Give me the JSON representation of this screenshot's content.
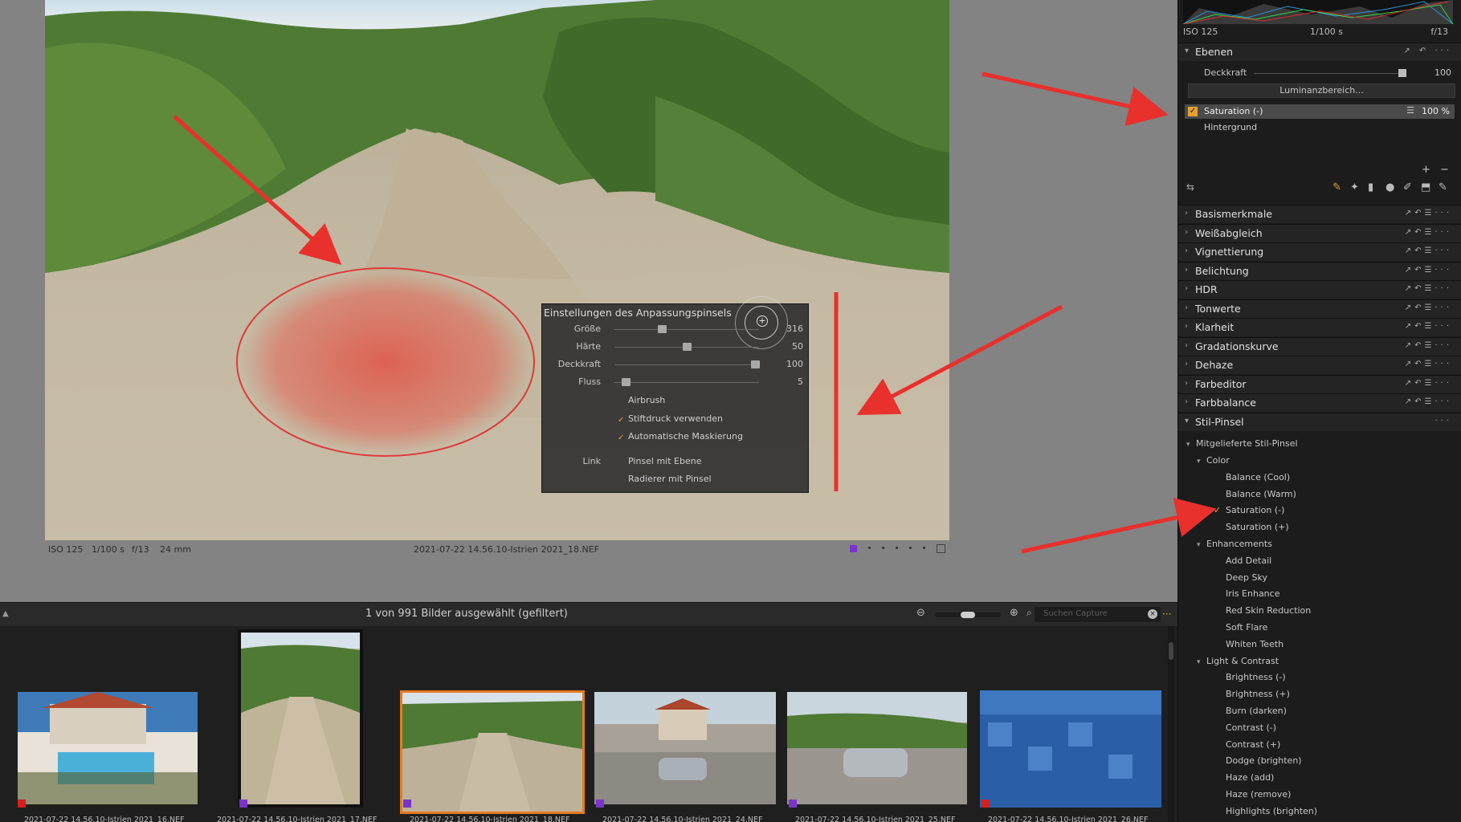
{
  "viewer": {
    "info": {
      "iso": "ISO 125",
      "shutter": "1/100 s",
      "aperture": "f/13",
      "focal": "24 mm",
      "filename": "2021-07-22 14.56.10-Istrien 2021_18.NEF"
    },
    "active_color": "#7a34c8"
  },
  "brush_dialog": {
    "title": "Einstellungen des Anpassungspinsels",
    "sliders": [
      {
        "label": "Größe",
        "value": "316",
        "fraction": 0.32
      },
      {
        "label": "Härte",
        "value": "50",
        "fraction": 0.5
      },
      {
        "label": "Deckkraft",
        "value": "100",
        "fraction": 1.0
      },
      {
        "label": "Fluss",
        "value": "5",
        "fraction": 0.05
      }
    ],
    "options": [
      {
        "label": "Airbrush",
        "checked": false
      },
      {
        "label": "Stiftdruck verwenden",
        "checked": true
      },
      {
        "label": "Automatische Maskierung",
        "checked": true
      }
    ],
    "link_label": "Link",
    "link_options": [
      {
        "label": "Pinsel mit Ebene",
        "checked": false
      },
      {
        "label": "Radierer mit Pinsel",
        "checked": false
      }
    ]
  },
  "filmstrip": {
    "title": "1 von 991 Bilder ausgewählt (gefiltert)",
    "search_placeholder": "Suchen Capture",
    "clear_glyph": "×",
    "menu_glyph": "···",
    "thumbnails": [
      {
        "label": "2021-07-22 14.56.10-Istrien 2021_16.NEF",
        "tag_color": "#d42020",
        "selected": false
      },
      {
        "label": "2021-07-22 14.56.10-Istrien 2021_17.NEF",
        "tag_color": "#7a34c8",
        "selected": false
      },
      {
        "label": "2021-07-22 14.56.10-Istrien 2021_18.NEF",
        "tag_color": "#7a34c8",
        "selected": true
      },
      {
        "label": "2021-07-22 14.56.10-Istrien 2021_24.NEF",
        "tag_color": "#7a34c8",
        "selected": false
      },
      {
        "label": "2021-07-22 14.56.10-Istrien 2021_25.NEF",
        "tag_color": "#7a34c8",
        "selected": false
      },
      {
        "label": "2021-07-22 14.56.10-Istrien 2021_26.NEF",
        "tag_color": "#d42020",
        "selected": false
      }
    ]
  },
  "panel": {
    "meta": {
      "iso": "ISO 125",
      "shutter": "1/100 s",
      "aperture": "f/13"
    },
    "layers": {
      "title": "Ebenen",
      "opacity_label": "Deckkraft",
      "opacity_value": "100",
      "luminance_button": "Luminanzbereich...",
      "items": [
        {
          "name": "Saturation (-)",
          "value": "100 %",
          "checked": true
        },
        {
          "name": "Hintergrund",
          "value": "",
          "checked": false
        }
      ]
    },
    "sections": [
      "Basismerkmale",
      "Weißabgleich",
      "Vignettierung",
      "Belichtung",
      "HDR",
      "Tonwerte",
      "Klarheit",
      "Gradationskurve",
      "Dehaze",
      "Farbeditor",
      "Farbbalance"
    ],
    "style_brushes": {
      "title": "Stil-Pinsel",
      "root": "Mitgelieferte Stil-Pinsel",
      "groups": [
        {
          "name": "Color",
          "items": [
            "Balance (Cool)",
            "Balance (Warm)",
            "Saturation (-)",
            "Saturation (+)"
          ],
          "checked_index": 2
        },
        {
          "name": "Enhancements",
          "items": [
            "Add Detail",
            "Deep Sky",
            "Iris Enhance",
            "Red Skin Reduction",
            "Soft Flare",
            "Whiten Teeth"
          ]
        },
        {
          "name": "Light & Contrast",
          "items": [
            "Brightness (-)",
            "Brightness (+)",
            "Burn (darken)",
            "Contrast (-)",
            "Contrast (+)",
            "Dodge (brighten)",
            "Haze (add)",
            "Haze (remove)",
            "Highlights (brighten)"
          ]
        }
      ]
    },
    "accent": "#e8a030"
  }
}
